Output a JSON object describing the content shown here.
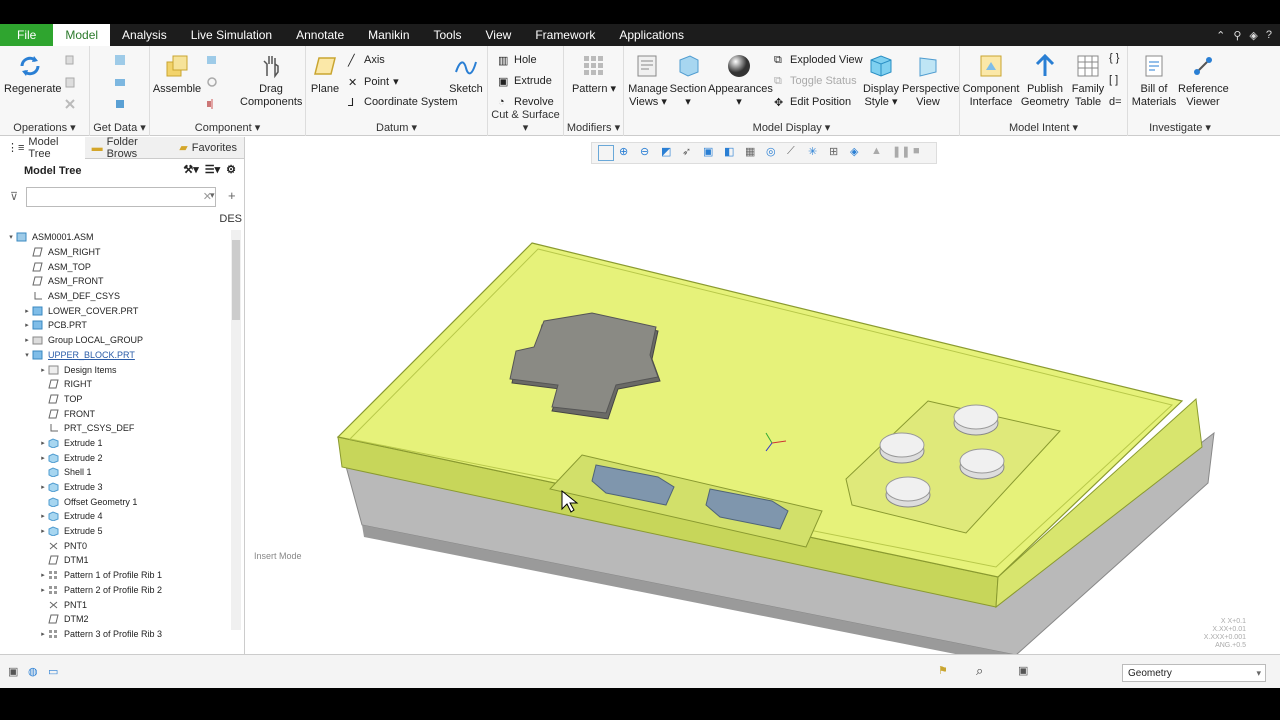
{
  "tabs": [
    "File",
    "Model",
    "Analysis",
    "Live Simulation",
    "Annotate",
    "Manikin",
    "Tools",
    "View",
    "Framework",
    "Applications"
  ],
  "ribbon": {
    "regenerate": "Regenerate",
    "operations": "Operations",
    "get_data": "Get Data",
    "assemble": "Assemble",
    "drag_components": [
      "Drag",
      "Components"
    ],
    "component": "Component",
    "plane": "Plane",
    "axis": "Axis",
    "point": "Point",
    "coordinate_system": "Coordinate System",
    "sketch": "Sketch",
    "datum": "Datum",
    "hole": "Hole",
    "extrude": "Extrude",
    "revolve": "Revolve",
    "cut_surface": "Cut & Surface",
    "pattern": "Pattern",
    "modifiers": "Modifiers",
    "manage_views": [
      "Manage",
      "Views"
    ],
    "section": "Section",
    "appearances": "Appearances",
    "exploded_view": "Exploded View",
    "toggle_status": "Toggle Status",
    "edit_position": "Edit Position",
    "display_style": [
      "Display",
      "Style"
    ],
    "perspective_view": [
      "Perspective",
      "View"
    ],
    "model_display": "Model Display",
    "component_interface": [
      "Component",
      "Interface"
    ],
    "publish_geometry": [
      "Publish",
      "Geometry"
    ],
    "family_table": [
      "Family",
      "Table"
    ],
    "model_intent": "Model Intent",
    "bill_of_materials": [
      "Bill of",
      "Materials"
    ],
    "reference_viewer": [
      "Reference",
      "Viewer"
    ],
    "investigate": "Investigate"
  },
  "panel": {
    "tabs": [
      "Model Tree",
      "Folder Brows",
      "Favorites"
    ],
    "title": "Model Tree",
    "column": "DES",
    "tree": [
      {
        "label": "ASM0001.ASM",
        "level": 0,
        "exp": "▾",
        "icon": "assembly"
      },
      {
        "label": "ASM_RIGHT",
        "level": 1,
        "exp": "",
        "icon": "plane"
      },
      {
        "label": "ASM_TOP",
        "level": 1,
        "exp": "",
        "icon": "plane"
      },
      {
        "label": "ASM_FRONT",
        "level": 1,
        "exp": "",
        "icon": "plane"
      },
      {
        "label": "ASM_DEF_CSYS",
        "level": 1,
        "exp": "",
        "icon": "csys"
      },
      {
        "label": "LOWER_COVER.PRT",
        "level": 1,
        "exp": "▸",
        "icon": "part"
      },
      {
        "label": "PCB.PRT",
        "level": 1,
        "exp": "▸",
        "icon": "part"
      },
      {
        "label": "Group LOCAL_GROUP",
        "level": 1,
        "exp": "▸",
        "icon": "group"
      },
      {
        "label": "UPPER_BLOCK.PRT",
        "level": 1,
        "exp": "▾",
        "icon": "part"
      },
      {
        "label": "Design Items",
        "level": 2,
        "exp": "▸",
        "icon": "design"
      },
      {
        "label": "RIGHT",
        "level": 2,
        "exp": "",
        "icon": "plane"
      },
      {
        "label": "TOP",
        "level": 2,
        "exp": "",
        "icon": "plane"
      },
      {
        "label": "FRONT",
        "level": 2,
        "exp": "",
        "icon": "plane"
      },
      {
        "label": "PRT_CSYS_DEF",
        "level": 2,
        "exp": "",
        "icon": "csys"
      },
      {
        "label": "Extrude 1",
        "level": 2,
        "exp": "▸",
        "icon": "feature"
      },
      {
        "label": "Extrude 2",
        "level": 2,
        "exp": "▸",
        "icon": "feature"
      },
      {
        "label": "Shell 1",
        "level": 2,
        "exp": "",
        "icon": "feature"
      },
      {
        "label": "Extrude 3",
        "level": 2,
        "exp": "▸",
        "icon": "feature"
      },
      {
        "label": "Offset Geometry 1",
        "level": 2,
        "exp": "",
        "icon": "feature"
      },
      {
        "label": "Extrude 4",
        "level": 2,
        "exp": "▸",
        "icon": "feature"
      },
      {
        "label": "Extrude 5",
        "level": 2,
        "exp": "▸",
        "icon": "feature"
      },
      {
        "label": "PNT0",
        "level": 2,
        "exp": "",
        "icon": "point"
      },
      {
        "label": "DTM1",
        "level": 2,
        "exp": "",
        "icon": "plane"
      },
      {
        "label": "Pattern 1 of Profile Rib 1",
        "level": 2,
        "exp": "▸",
        "icon": "pattern"
      },
      {
        "label": "Pattern 2 of Profile Rib 2",
        "level": 2,
        "exp": "▸",
        "icon": "pattern"
      },
      {
        "label": "PNT1",
        "level": 2,
        "exp": "",
        "icon": "point"
      },
      {
        "label": "DTM2",
        "level": 2,
        "exp": "",
        "icon": "plane"
      },
      {
        "label": "Pattern 3 of Profile Rib 3",
        "level": 2,
        "exp": "▸",
        "icon": "pattern"
      }
    ]
  },
  "graphics": {
    "insert_mode": "Insert Mode",
    "accuracy": [
      "X X+0.1",
      "X.XX+0.01",
      "X.XXX+0.001",
      "ANG.+0.5"
    ]
  },
  "status": {
    "filter": "Geometry"
  },
  "colors": {
    "accent": "#2fa52f",
    "model_body": "#e6f27a",
    "model_base": "#c8c8c8"
  }
}
